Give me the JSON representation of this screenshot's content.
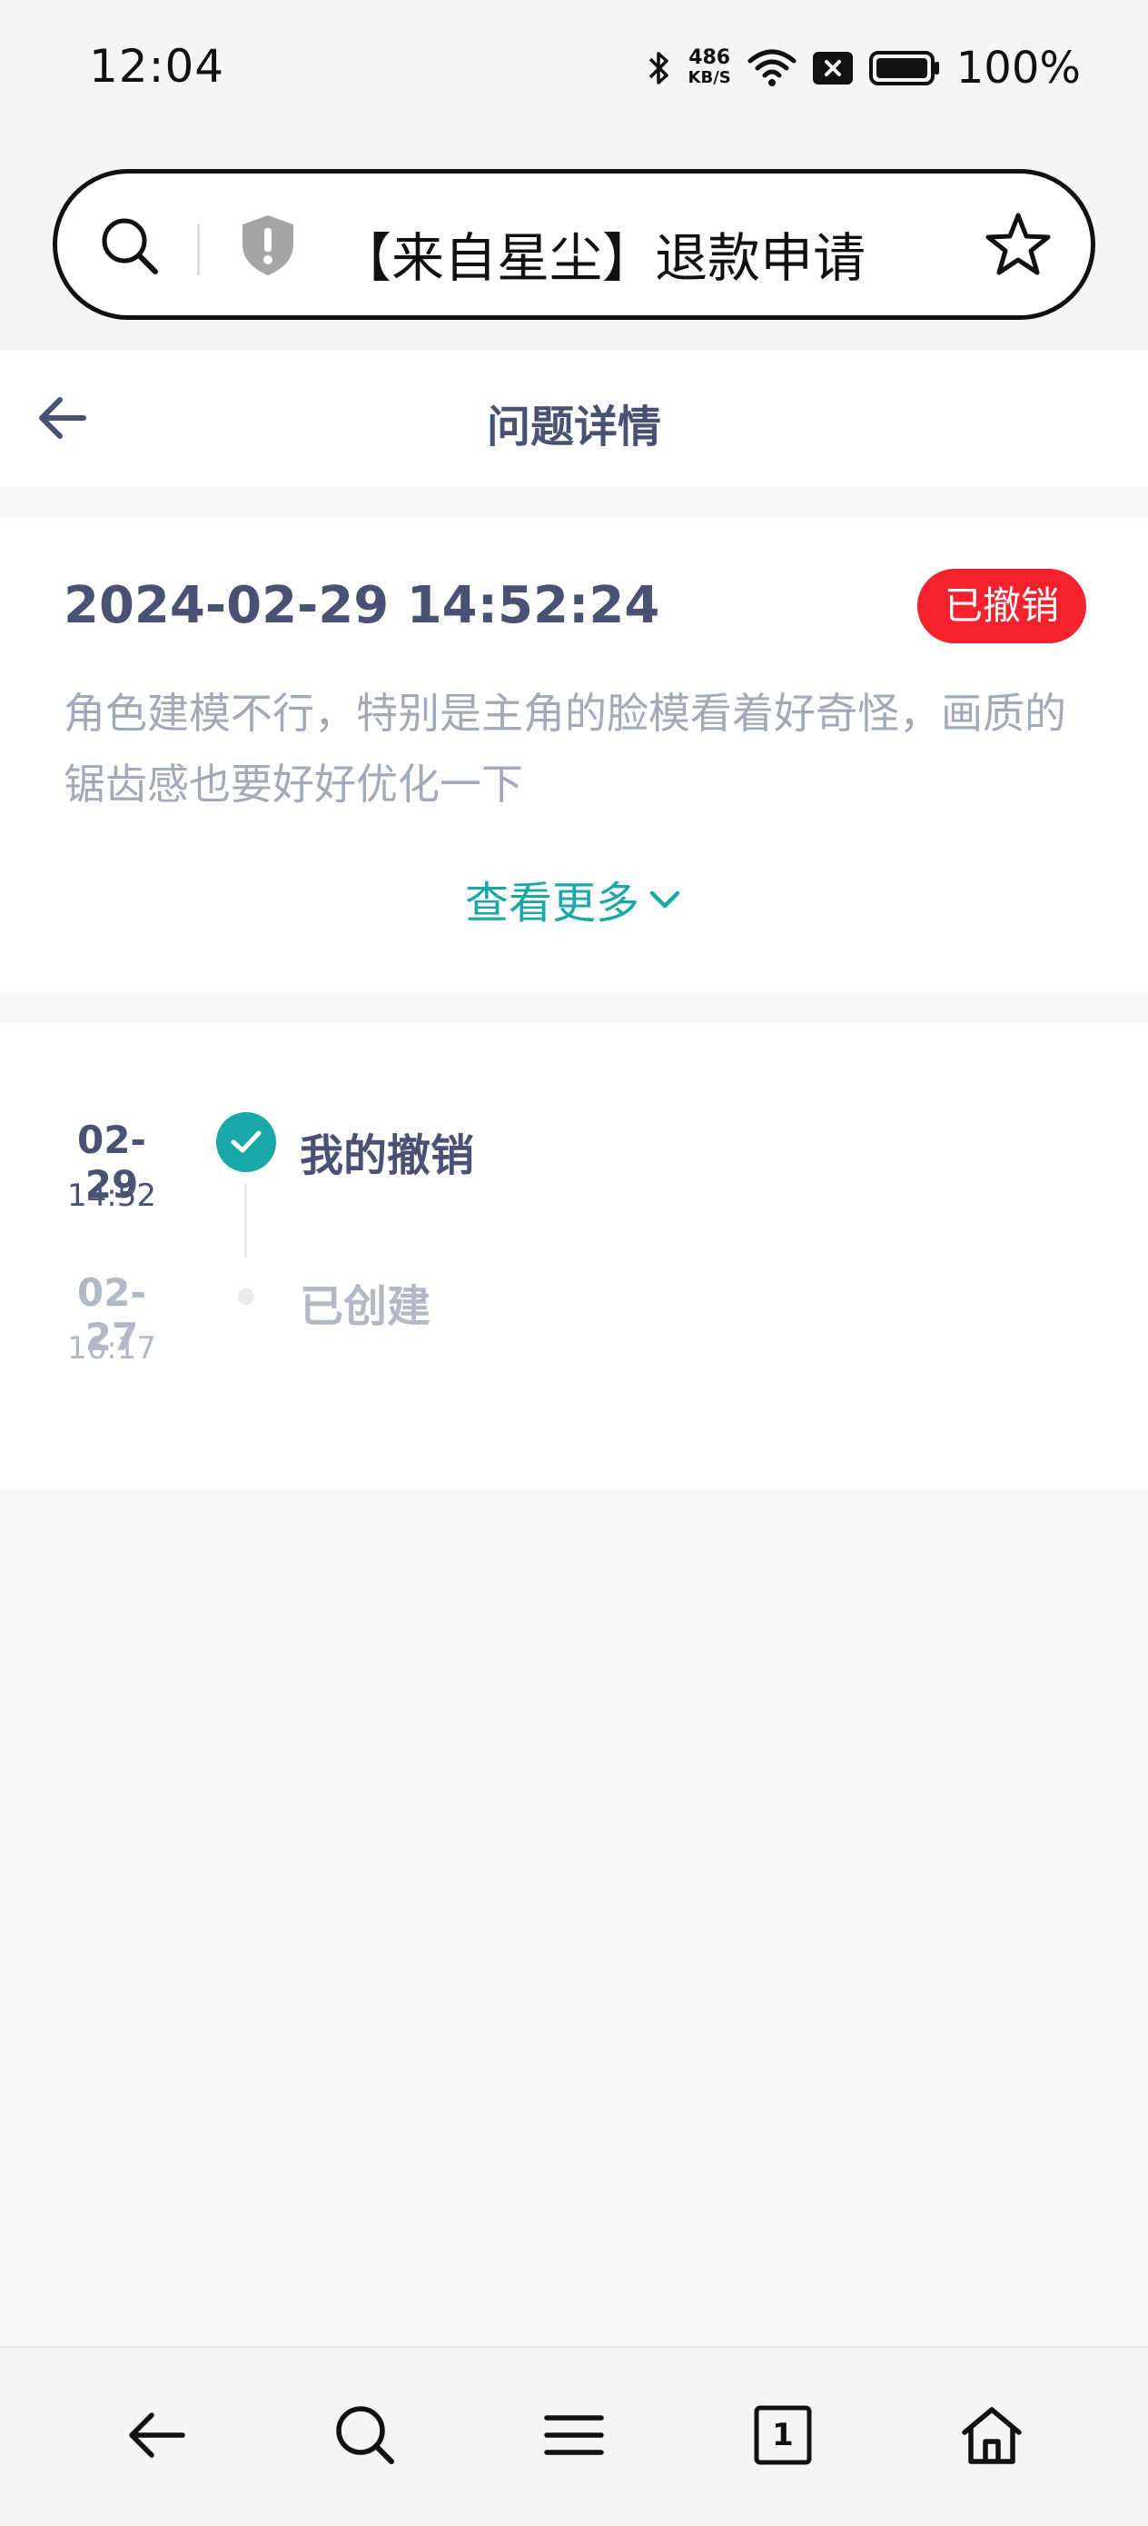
{
  "status_bar": {
    "time": "12:04",
    "net_speed": "486",
    "net_unit": "KB/S",
    "battery": "100%",
    "icons": [
      "bluetooth-icon",
      "wifi-icon",
      "sim-off-icon",
      "battery-icon"
    ]
  },
  "browser": {
    "url_text": "【来自星尘】退款申请",
    "icons": [
      "search-icon",
      "shield-icon",
      "star-icon"
    ]
  },
  "header": {
    "title": "问题详情"
  },
  "issue": {
    "time": "2024-02-29 14:52:24",
    "status": "已撤销",
    "description": "角色建模不行，特别是主角的脸模看着好奇怪，画质的锯齿感也要好好优化一下",
    "view_more": "查看更多"
  },
  "timeline": [
    {
      "date": "02-29",
      "time": "14:52",
      "label": "我的撤销",
      "state": "done"
    },
    {
      "date": "02-27",
      "time": "16:17",
      "label": "已创建",
      "state": "inactive"
    }
  ],
  "bottom_nav": [
    "back-icon",
    "search-icon",
    "menu-icon",
    "tabs-icon",
    "home-icon"
  ],
  "bottom_nav_tab_count": "1",
  "colors": {
    "accent": "#1aa7a7",
    "badge_red": "#f5222d",
    "title_text": "#4a5274",
    "muted_text": "#a4a9b9"
  }
}
